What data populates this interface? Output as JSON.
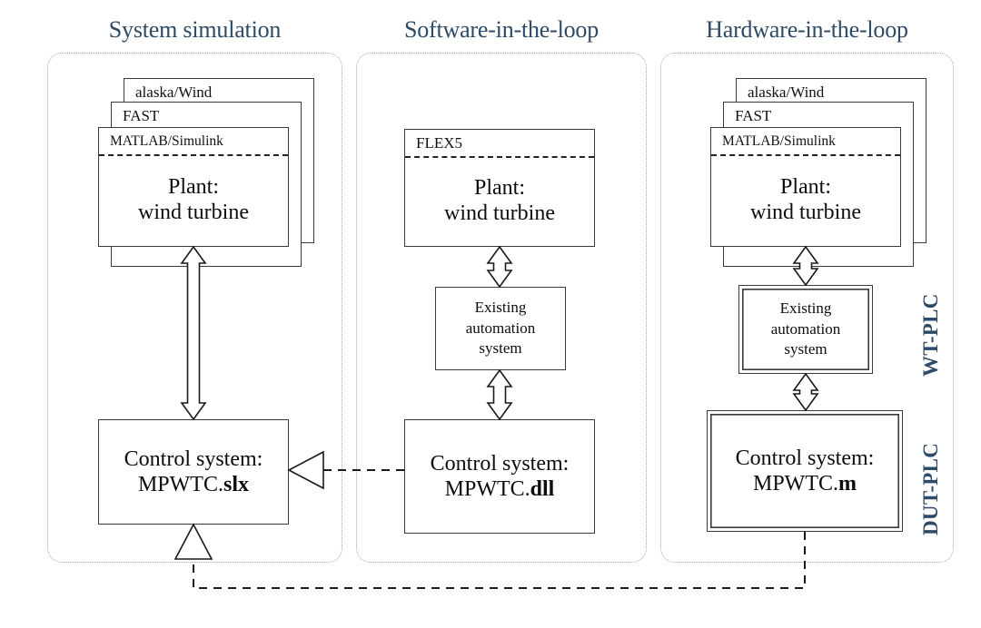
{
  "columns": [
    {
      "id": "system-simulation",
      "title": "System simulation",
      "plant": {
        "stack_tags": [
          "alaska/Wind",
          "FAST",
          "MATLAB/Simulink"
        ],
        "label_line1": "Plant:",
        "label_line2": "wind turbine"
      },
      "automation": null,
      "control": {
        "line1": "Control system:",
        "prefix": "MPWTC.",
        "extension": "slx"
      }
    },
    {
      "id": "software-in-the-loop",
      "title": "Software-in-the-loop",
      "plant": {
        "stack_tags": [
          "FLEX5"
        ],
        "label_line1": "Plant:",
        "label_line2": "wind turbine"
      },
      "automation": {
        "line1": "Existing",
        "line2": "automation",
        "line3": "system",
        "double_border": false
      },
      "control": {
        "line1": "Control system:",
        "prefix": "MPWTC.",
        "extension": "dll"
      }
    },
    {
      "id": "hardware-in-the-loop",
      "title": "Hardware-in-the-loop",
      "plant": {
        "stack_tags": [
          "alaska/Wind",
          "FAST",
          "MATLAB/Simulink"
        ],
        "label_line1": "Plant:",
        "label_line2": "wind turbine"
      },
      "automation": {
        "line1": "Existing",
        "line2": "automation",
        "line3": "system",
        "double_border": true
      },
      "control": {
        "line1": "Control system:",
        "prefix": "MPWTC.",
        "extension": "m"
      }
    }
  ],
  "side_labels": {
    "wt_plc": "WT-PLC",
    "dut_plc": "DUT-PLC"
  },
  "colors": {
    "title": "#2d4a66",
    "lane_border": "#9aa7bb",
    "box_border": "#3a3a3a",
    "connector": "#1a1a1a",
    "text": "#0d0d0d"
  }
}
